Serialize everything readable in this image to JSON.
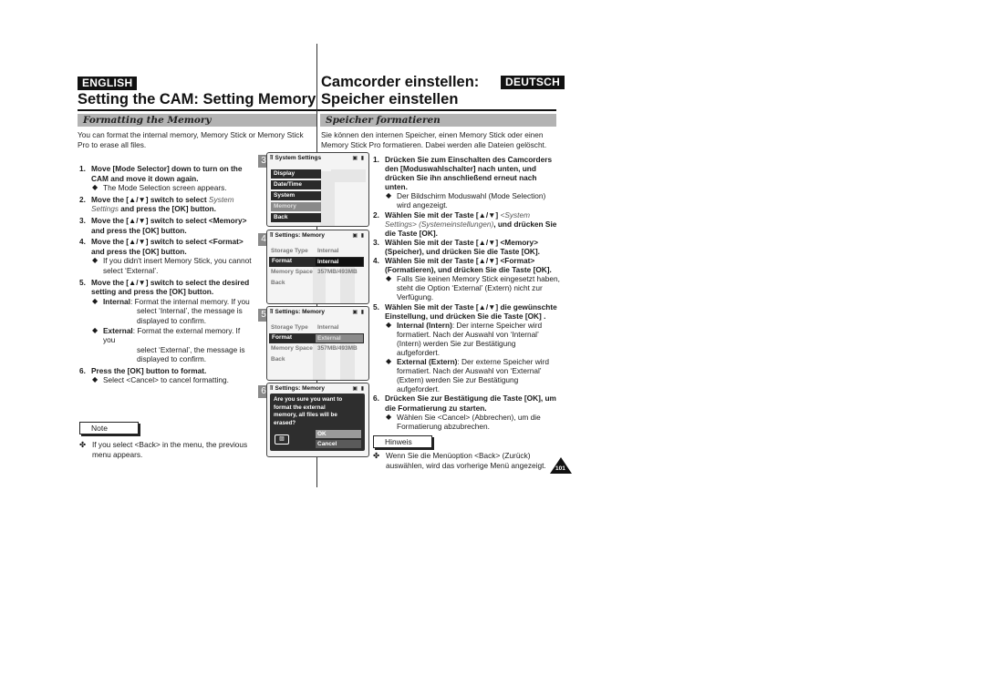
{
  "left": {
    "language_badge": "ENGLISH",
    "title": "Setting the CAM: Setting Memory",
    "section": "Formatting the Memory",
    "intro": "You can format the internal memory, Memory Stick or Memory Stick Pro to erase all files.",
    "steps": [
      {
        "num": "1.",
        "text": "Move [Mode Selector] down to turn on the CAM and move it down again.",
        "bullets": [
          {
            "text": "The Mode Selection screen appears."
          }
        ]
      },
      {
        "num": "2.",
        "text_a": "Move the [▲/▼] switch to select ",
        "italic": "System Settings",
        "text_b": " and press the [OK] button."
      },
      {
        "num": "3.",
        "text": "Move the [▲/▼] switch to select <Memory> and press the [OK] button."
      },
      {
        "num": "4.",
        "text": "Move the [▲/▼] switch to select <Format> and press the [OK] button.",
        "bullets": [
          {
            "text": "If you didn't insert Memory Stick, you cannot select ‘External’."
          }
        ]
      },
      {
        "num": "5.",
        "text": "Move the [▲/▼] switch to select the desired setting and press the [OK] button.",
        "bullets": [
          {
            "label": "Internal",
            "text": ": Format the internal memory. If you",
            "cont": "select ‘Internal’, the message is displayed to confirm."
          },
          {
            "label": "External",
            "text": ": Format the external memory. If you",
            "cont": "select ‘External’, the message is displayed to confirm."
          }
        ]
      },
      {
        "num": "6.",
        "text": "Press the [OK] button to format.",
        "bullets": [
          {
            "text": "Select <Cancel> to cancel formatting."
          }
        ]
      }
    ],
    "note_label": "Note",
    "note_text": "If you select <Back> in the menu, the previous menu appears."
  },
  "right": {
    "title_line1": "Camcorder einstellen:",
    "title_line2": "Speicher einstellen",
    "language_badge": "DEUTSCH",
    "section": "Speicher formatieren",
    "intro": "Sie können den internen Speicher, einen Memory Stick oder einen Memory Stick Pro formatieren. Dabei werden alle Dateien gelöscht.",
    "steps": [
      {
        "num": "1.",
        "text": "Drücken Sie zum Einschalten des Camcorders den [Moduswahlschalter] nach unten, und drücken Sie ihn anschließend erneut nach unten.",
        "bullets": [
          {
            "text": "Der Bildschirm Moduswahl (Mode Selection) wird angezeigt."
          }
        ]
      },
      {
        "num": "2.",
        "text_a": "Wählen Sie mit der Taste [▲/▼] ",
        "italic": "<System Settings> (Systemeinstellungen)",
        "text_b": ", und drücken Sie die Taste [OK]."
      },
      {
        "num": "3.",
        "text": "Wählen Sie mit der Taste [▲/▼] <Memory> (Speicher), und drücken Sie die Taste [OK]."
      },
      {
        "num": "4.",
        "text": "Wählen Sie mit der Taste [▲/▼] <Format> (Formatieren), und drücken Sie die Taste [OK].",
        "bullets": [
          {
            "text": "Falls Sie keinen Memory Stick eingesetzt haben, steht die Option ‘External’ (Extern) nicht zur Verfügung."
          }
        ]
      },
      {
        "num": "5.",
        "text": "Wählen Sie mit der Taste [▲/▼] die gewünschte Einstellung, und drücken Sie die Taste [OK] .",
        "bullets": [
          {
            "label": "Internal (Intern)",
            "text": ": Der interne Speicher wird formatiert. Nach der Auswahl von ‘Internal’ (Intern) werden Sie zur Bestätigung aufgefordert."
          },
          {
            "label": "External (Extern)",
            "text": ": Der externe Speicher wird formatiert. Nach der Auswahl von ‘External’ (Extern) werden Sie zur Bestätigung aufgefordert."
          }
        ]
      },
      {
        "num": "6.",
        "text": "Drücken Sie zur Bestätigung die Taste [OK], um die Formatierung zu starten.",
        "bullets": [
          {
            "text": "Wählen Sie <Cancel> (Abbrechen), um die Formatierung abzubrechen."
          }
        ]
      }
    ],
    "note_label": "Hinweis",
    "note_text": "Wenn Sie die Menüoption <Back> (Zurück) auswählen, wird das vorherige Menü angezeigt."
  },
  "screens": [
    {
      "step": "3",
      "title": "System Settings",
      "icons": "▣ ▮",
      "menu": [
        "Display",
        "Date/Time",
        "System",
        "Memory",
        "Back"
      ],
      "selected_index": 3
    },
    {
      "step": "4",
      "title": "Settings: Memory",
      "icons": "▣ ▮",
      "rows": [
        {
          "label": "Storage Type",
          "value": "Internal"
        },
        {
          "label": "Format",
          "value": "Internal"
        },
        {
          "label": "Memory Space",
          "value": "357MB/493MB"
        },
        {
          "label": "Back",
          "value": ""
        }
      ],
      "highlight_index": 1
    },
    {
      "step": "5",
      "title": "Settings: Memory",
      "icons": "▣ ▮",
      "rows": [
        {
          "label": "Storage Type",
          "value": "Internal"
        },
        {
          "label": "Format",
          "value": "External"
        },
        {
          "label": "Memory Space",
          "value": "357MB/493MB"
        },
        {
          "label": "Back",
          "value": ""
        }
      ],
      "highlight_index": 1
    },
    {
      "step": "6",
      "title": "Settings: Memory",
      "icons": "▣ ▮",
      "dialog": {
        "message": "Are you sure you want to format the external memory, all files will be erased?",
        "ok": "OK",
        "cancel": "Cancel"
      }
    }
  ],
  "page_number": "101"
}
